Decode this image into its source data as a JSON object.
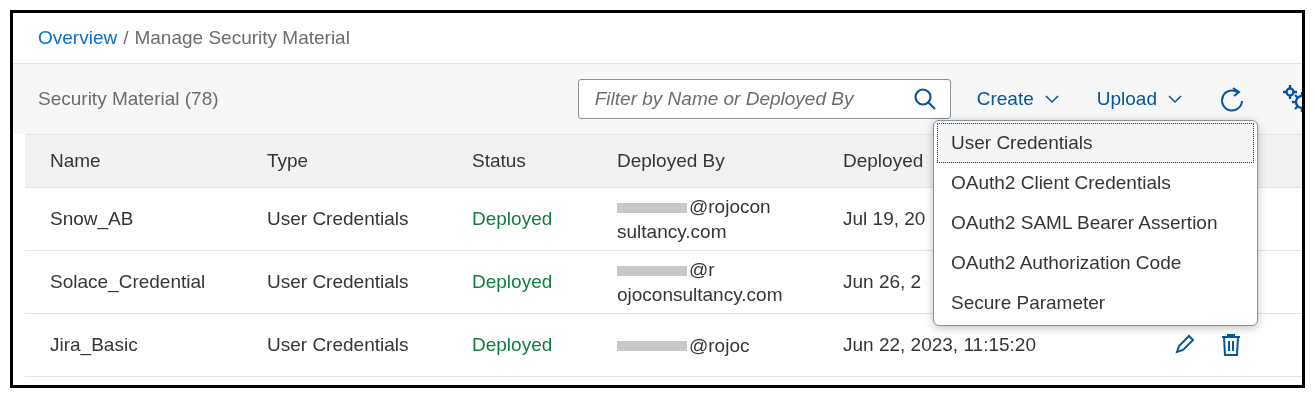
{
  "breadcrumb": {
    "link": "Overview",
    "separator": "/",
    "current": "Manage Security Material"
  },
  "toolbar": {
    "title": "Security Material (78)",
    "search": {
      "placeholder": "Filter by Name or Deployed By"
    },
    "buttons": [
      {
        "label": "Create",
        "kind": "menu"
      },
      {
        "label": "Upload",
        "kind": "menu"
      }
    ],
    "icons": [
      {
        "kind": "refresh"
      },
      {
        "kind": "settings"
      }
    ]
  },
  "table": {
    "columns": [
      "Name",
      "Type",
      "Status",
      "Deployed By",
      "Deployed"
    ],
    "rows": [
      {
        "name": "Snow_AB",
        "type": "User Credentials",
        "status": "Deployed",
        "deployed_by": [
          "@rojocon",
          "sultancy.com"
        ],
        "deployed_on": "Jul 19, 20"
      },
      {
        "name": "Solace_Credential",
        "type": "User Credentials",
        "status": "Deployed",
        "deployed_by": [
          "@r",
          "ojoconsultancy.com"
        ],
        "deployed_on": "Jun 26, 2"
      },
      {
        "name": "Jira_Basic",
        "type": "User Credentials",
        "status": "Deployed",
        "deployed_by": [
          "@rojoc"
        ],
        "deployed_on": "Jun 22, 2023, 11:15:20",
        "actions": [
          {
            "kind": "edit"
          },
          {
            "kind": "delete"
          }
        ]
      }
    ]
  },
  "create_menu": {
    "items": [
      {
        "label": "User Credentials",
        "selected": true
      },
      {
        "label": "OAuth2 Client Credentials",
        "selected": false
      },
      {
        "label": "OAuth2 SAML Bearer Assertion",
        "selected": false
      },
      {
        "label": "OAuth2 Authorization Code",
        "selected": false
      },
      {
        "label": "Secure Parameter",
        "selected": false
      }
    ]
  }
}
